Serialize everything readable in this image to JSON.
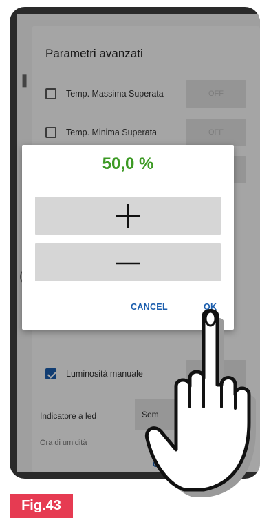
{
  "advanced_dialog": {
    "title": "Parametri avanzati",
    "rows": [
      {
        "label": "Temp. Massima Superata",
        "checked": false,
        "toggle": "OFF"
      },
      {
        "label": "Temp. Minima Superata",
        "checked": false,
        "toggle": "OFF"
      },
      {
        "label": "",
        "checked": true,
        "toggle": ""
      },
      {
        "label": "Luminosità manuale",
        "checked": true,
        "toggle": ""
      }
    ],
    "led_indicator_label": "Indicatore a led",
    "led_indicator_value": "Sem",
    "faded_text": "Ora di umidità",
    "cancel_label": "CA"
  },
  "value_dialog": {
    "value": "50,0 %",
    "cancel_label": "CANCEL",
    "ok_label": "OK"
  },
  "figure_label": "Fig.43",
  "colors": {
    "value_green": "#3d9a25",
    "accent_blue": "#1a5dad",
    "figure_red": "#e63b52"
  },
  "icons": {
    "increment": "plus-icon",
    "decrement": "minus-icon",
    "pointer": "pointing-hand-icon"
  }
}
